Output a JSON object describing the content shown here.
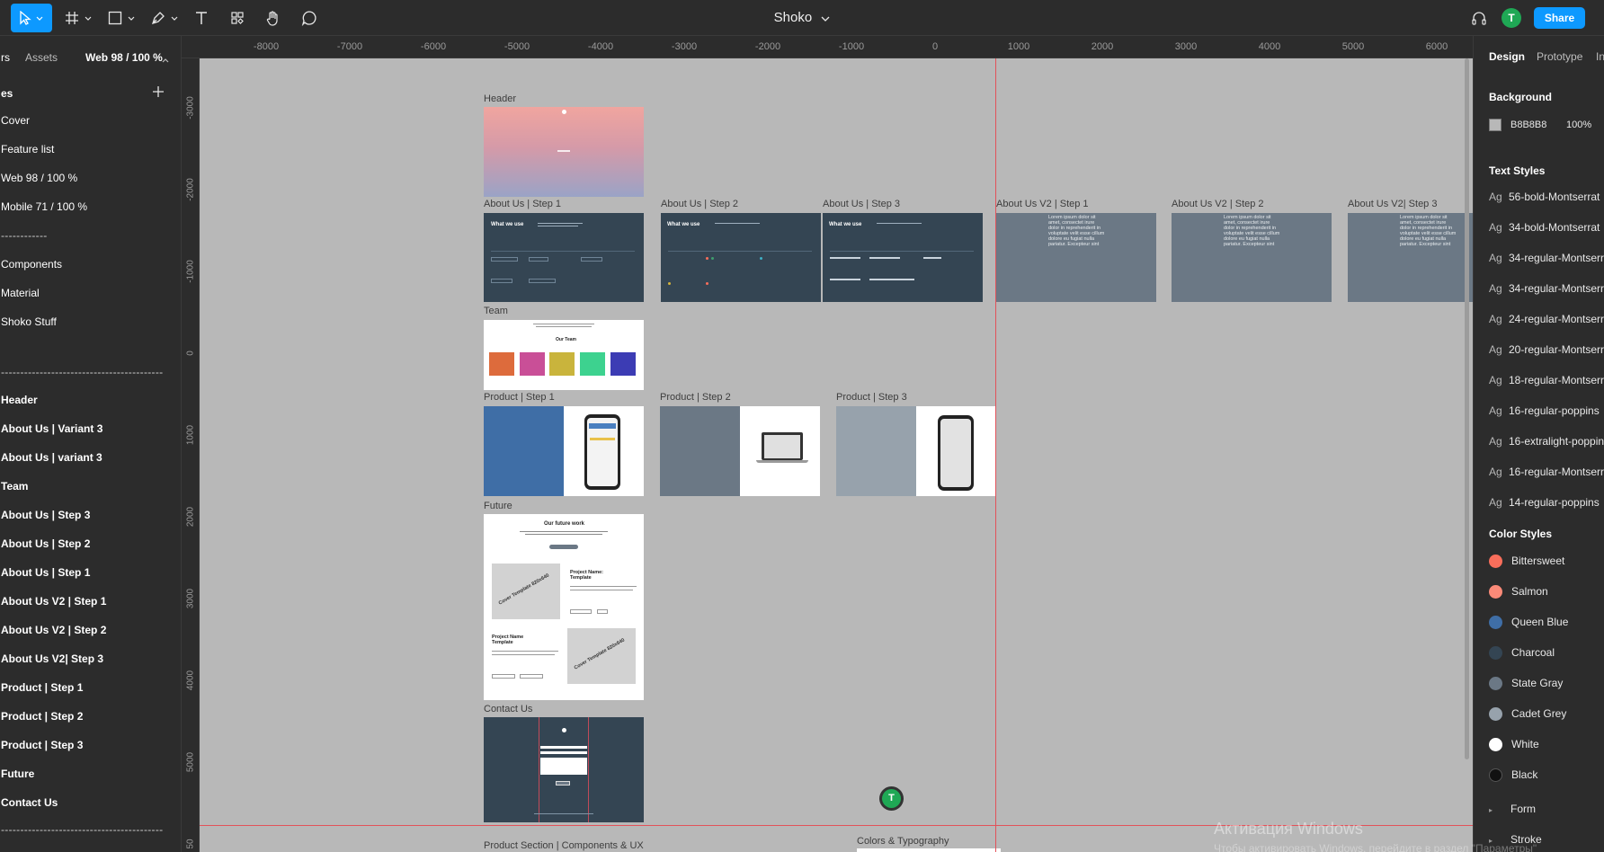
{
  "file_title": "Shoko",
  "share_label": "Share",
  "avatar_initial": "T",
  "left_panel": {
    "tab_layers": "rs",
    "tab_assets": "Assets",
    "page_selector": "Web 98 / 100 %",
    "pages_header": "es",
    "pages": [
      "Cover",
      "Feature list",
      "Web  98 / 100 %",
      "Mobile 71 / 100 %",
      "------------",
      "Components",
      "Material",
      "Shoko Stuff"
    ],
    "divider": "------------------------------------------",
    "layers": [
      "Header",
      "About Us | Variant 3",
      "About Us | variant 3",
      "Team",
      "About Us  | Step 3",
      "About Us  | Step 2",
      "About Us  | Step 1",
      "About Us V2 | Step 1",
      "About Us V2 | Step 2",
      "About Us V2| Step 3",
      "Product | Step 1",
      "Product | Step 2",
      "Product | Step 3",
      "Future",
      "Contact Us"
    ],
    "divider_bottom": "------------------------------------------"
  },
  "ruler_top": [
    "-8000",
    "-7000",
    "-6000",
    "-5000",
    "-4000",
    "-3000",
    "-2000",
    "-1000",
    "0",
    "1000",
    "2000",
    "3000",
    "4000",
    "5000",
    "6000"
  ],
  "ruler_left": [
    "-3000",
    "-2000",
    "-1000",
    "0",
    "1000",
    "2000",
    "3000",
    "4000",
    "5000",
    "50"
  ],
  "canvas": {
    "frames": {
      "header": "Header",
      "about1": "About Us  | Step 1",
      "about2": "About Us  | Step 2",
      "about3": "About Us  | Step 3",
      "aboutv2_1": "About Us V2 | Step 1",
      "aboutv2_2": "About Us V2 | Step 2",
      "aboutv2_3": "About Us V2| Step 3",
      "team": "Team",
      "product1": "Product | Step 1",
      "product2": "Product | Step 2",
      "product3": "Product | Step 3",
      "future": "Future",
      "contact": "Contact Us",
      "product_section": "Product Section | Components & UX",
      "colors_typo": "Colors & Typography"
    },
    "what_we_use": "What we use",
    "our_team": "Our Team",
    "our_future_work": "Our future work",
    "project_name": "Project Name: Template",
    "project_name_2": "Project Name Template",
    "cover_template": "Cover Template 820x640",
    "lorem": "Lorem ipsum dolor sit amet, consectet irure dolor in reprehenderit in voluptate velit esse cillum dolore eu fugiat nulla pariatur. Excepteur sint",
    "collab_initial": "T"
  },
  "right_panel": {
    "tab_design": "Design",
    "tab_prototype": "Prototype",
    "tab_inspect": "In",
    "background_title": "Background",
    "background_hex": "B8B8B8",
    "background_opacity": "100%",
    "text_styles_title": "Text Styles",
    "text_styles": [
      "56-bold-Montserrat",
      "34-bold-Montserrat",
      "34-regular-Montserrat",
      "34-regular-Montserrat",
      "24-regular-Montserrat",
      "20-regular-Montserrat",
      "18-regular-Montserrat",
      "16-regular-poppins",
      "16-extralight-poppins",
      "16-regular-Montserrat",
      "14-regular-poppins"
    ],
    "color_styles_title": "Color Styles",
    "color_styles": [
      {
        "name": "Bittersweet",
        "color": "#f96e5b"
      },
      {
        "name": "Salmon",
        "color": "#fa8a78"
      },
      {
        "name": "Queen Blue",
        "color": "#3f6ea6"
      },
      {
        "name": "Charcoal",
        "color": "#344553"
      },
      {
        "name": "State Gray",
        "color": "#6b7885"
      },
      {
        "name": "Cadet Grey",
        "color": "#97a2ac"
      },
      {
        "name": "White",
        "color": "#ffffff"
      },
      {
        "name": "Black",
        "color": "#111111"
      }
    ],
    "groups": [
      "Form",
      "Stroke"
    ]
  },
  "watermark": "Активация Windows",
  "watermark_sub": "Чтобы активировать Windows, перейдите в раздел \"Параметры\""
}
